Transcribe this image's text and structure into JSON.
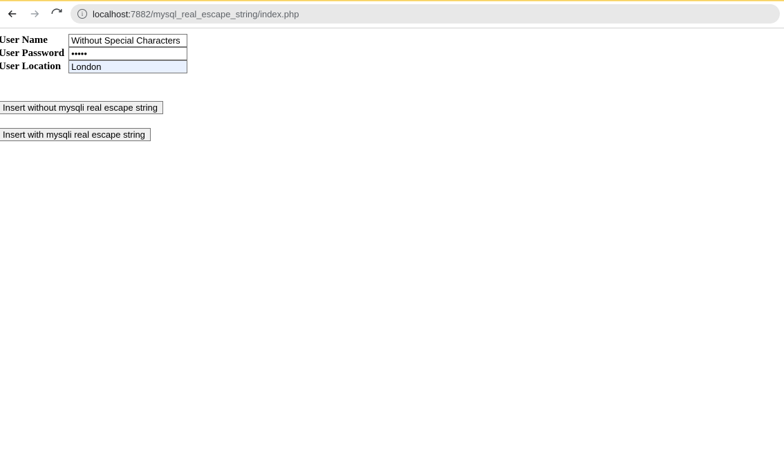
{
  "browser": {
    "url_host": "localhost:",
    "url_path": "7882/mysql_real_escape_string/index.php"
  },
  "form": {
    "username_label": "User Name",
    "username_value": "Without Special Characters",
    "password_label": "User Password",
    "password_value": "•••••",
    "location_label": "User Location",
    "location_value": "London"
  },
  "buttons": {
    "insert_without": "Insert without mysqli real escape string",
    "insert_with": "Insert with mysqli real escape string"
  }
}
